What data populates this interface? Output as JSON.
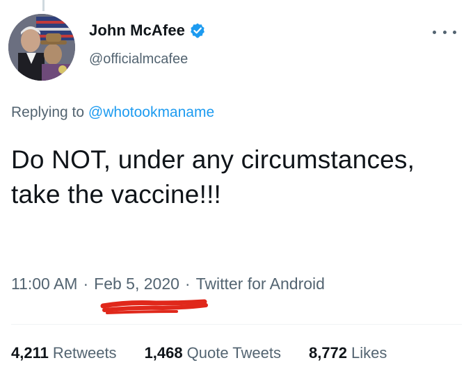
{
  "author": {
    "display_name": "John McAfee",
    "handle": "@officialmcafee",
    "verified": true,
    "avatar_icon": "profile-photo"
  },
  "menu": {
    "icon": "more-options-icon"
  },
  "reply": {
    "prefix": "Replying to",
    "mention": "@whotookmaname"
  },
  "tweet": {
    "text": "Do NOT, under any circumstances, take the vaccine!!!"
  },
  "meta": {
    "time": "11:00 AM",
    "date": "Feb 5, 2020",
    "source": "Twitter for Android",
    "separator": "·"
  },
  "stats": {
    "retweets": {
      "count": "4,211",
      "label": "Retweets"
    },
    "quote_tweets": {
      "count": "1,468",
      "label": "Quote Tweets"
    },
    "likes": {
      "count": "8,772",
      "label": "Likes"
    }
  },
  "colors": {
    "text_primary": "#0f1419",
    "text_secondary": "#536471",
    "accent": "#1d9bf0",
    "annotation_red": "#e0281b"
  }
}
